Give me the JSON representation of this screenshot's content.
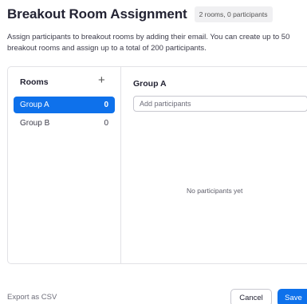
{
  "dialog": {
    "title": "Breakout Room Assignment",
    "count_badge": "2 rooms, 0 participants",
    "description": "Assign participants to breakout rooms by adding their email. You can create up to 50 breakout rooms and assign up to a total of 200 participants."
  },
  "rooms": {
    "header": "Rooms",
    "add_icon": "plus-icon",
    "add_glyph": "+",
    "items": [
      {
        "name": "Group A",
        "count": "0",
        "selected": true
      },
      {
        "name": "Group B",
        "count": "0",
        "selected": false
      }
    ]
  },
  "detail": {
    "title": "Group A",
    "input_placeholder": "Add participants",
    "empty_text": "No participants yet"
  },
  "footer": {
    "export_label": "Export as CSV",
    "cancel_label": "Cancel",
    "save_label": "Save"
  },
  "colors": {
    "accent": "#0e71eb",
    "border": "#e2e2e6",
    "text": "#232333"
  }
}
